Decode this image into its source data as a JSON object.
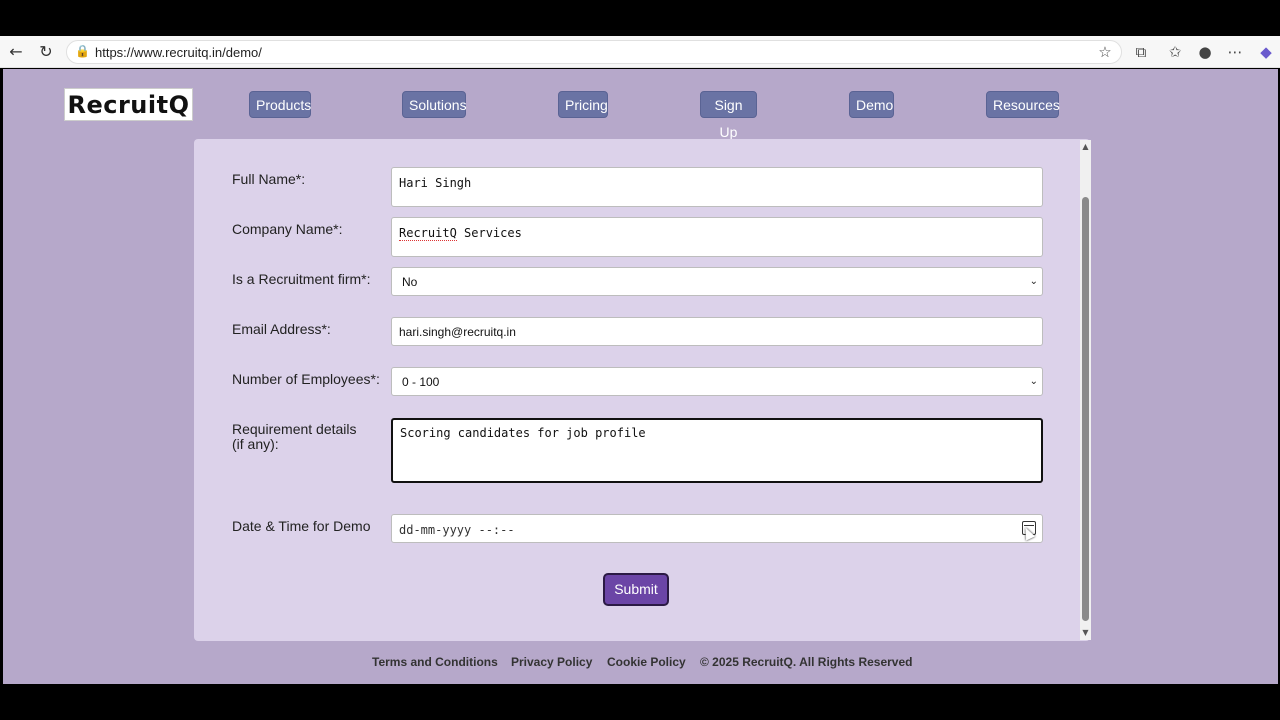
{
  "browser": {
    "url": "https://www.recruitq.in/demo/",
    "back_icon": "back-arrow-icon",
    "reload_icon": "reload-icon",
    "lock_icon": "lock-icon",
    "star_icon": "star-icon",
    "extensions_icon": "puzzle-icon",
    "favorites_icon": "favorites-icon",
    "profile_icon": "profile-icon",
    "menu_icon": "more-icon",
    "copilot_icon": "copilot-icon"
  },
  "header": {
    "logo": "RecruitQ",
    "nav": [
      "Products",
      "Solutions",
      "Pricing",
      "Sign Up",
      "Demo",
      "Resources"
    ]
  },
  "form": {
    "full_name_label": "Full Name*:",
    "full_name_value": "Hari Singh",
    "company_label": "Company Name*:",
    "company_value_word1": "RecruitQ",
    "company_value_word2": " Services",
    "recruitment_label": "Is a Recruitment firm*:",
    "recruitment_value": "No",
    "email_label": "Email Address*:",
    "email_value": "hari.singh@recruitq.in",
    "employees_label": "Number of Employees*:",
    "employees_value": "0 - 100",
    "requirement_label": "Requirement details (if any):",
    "requirement_value": "Scoring candidates for job profile",
    "datetime_label": "Date & Time for Demo",
    "datetime_placeholder": "dd-mm-yyyy --:--",
    "submit_label": "Submit"
  },
  "footer": {
    "terms": "Terms and Conditions",
    "privacy": "Privacy Policy",
    "cookie": "Cookie Policy",
    "copyright": "© 2025 RecruitQ. All Rights Reserved"
  },
  "colors": {
    "page_bg": "#b6a8ca",
    "panel_bg": "#dcd2ea",
    "nav_btn": "#6a73a4",
    "submit_btn": "#6b45a6"
  }
}
